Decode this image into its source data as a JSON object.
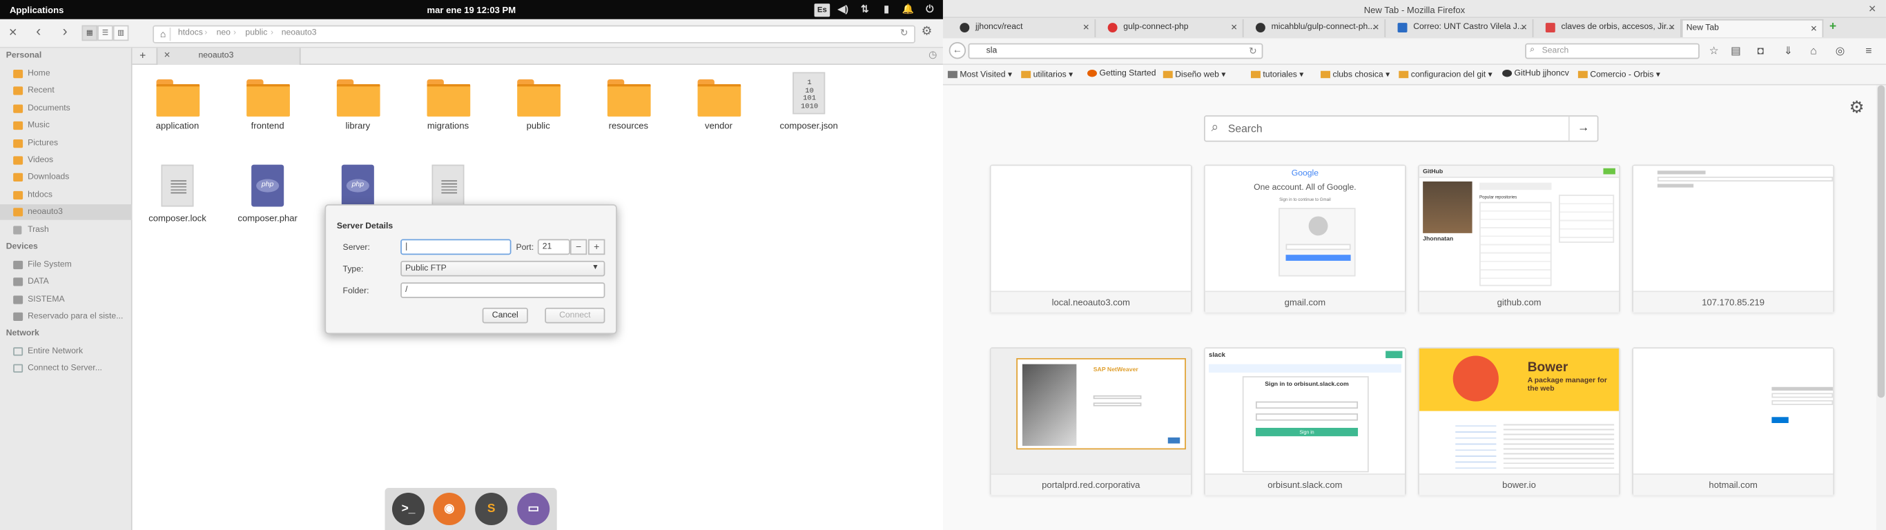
{
  "system": {
    "apps": "Applications",
    "clock": "mar ene 19   12:03 PM",
    "kb": "Es"
  },
  "fm": {
    "path": [
      "htdocs",
      "neo",
      "public",
      "neoauto3"
    ],
    "tab": "neoauto3",
    "sidebar": {
      "personal": "Personal",
      "items": [
        "Home",
        "Recent",
        "Documents",
        "Music",
        "Pictures",
        "Videos",
        "Downloads",
        "htdocs",
        "neoauto3",
        "Trash"
      ],
      "devices": "Devices",
      "dev_items": [
        "File System",
        "DATA",
        "SISTEMA",
        "Reservado para el siste..."
      ],
      "network": "Network",
      "net_items": [
        "Entire Network",
        "Connect to Server..."
      ]
    },
    "files": [
      "application",
      "frontend",
      "library",
      "migrations",
      "public",
      "resources",
      "vendor",
      "composer.json",
      "composer.lock",
      "composer.phar"
    ]
  },
  "dialog": {
    "title": "Server Details",
    "server": "Server:",
    "port": "Port:",
    "port_val": "21",
    "type": "Type:",
    "type_val": "Public FTP",
    "folder": "Folder:",
    "folder_val": "/",
    "cancel": "Cancel",
    "connect": "Connect"
  },
  "ff": {
    "window_title": "New Tab - Mozilla Firefox",
    "tabs": [
      "jjhoncv/react",
      "gulp-connect-php",
      "micahblu/gulp-connect-ph...",
      "Correo: UNT Castro Vilela J...",
      "claves de orbis, accesos, Jir...",
      "New Tab"
    ],
    "url": "sla",
    "search_ph": "Search",
    "bookmarks": [
      "Most Visited",
      "utilitarios",
      "Getting Started",
      "Diseño web",
      "tutoriales",
      "clubs chosica",
      "configuracion del git",
      "GitHub jjhoncv",
      "Comercio - Orbis"
    ],
    "nt_search": "Search",
    "tiles": [
      "local.neoauto3.com",
      "gmail.com",
      "github.com",
      "107.170.85.219",
      "portalprd.red.corporativa",
      "orbisunt.slack.com",
      "bower.io",
      "hotmail.com"
    ],
    "thumb": {
      "gmail_logo": "Google",
      "gmail_t1": "One account. All of Google.",
      "gmail_t2": "Sign in to continue to Gmail",
      "gh": "GitHub",
      "gh_name": "Jhonnatan",
      "gh_pop": "Popular repositories",
      "sap": "SAP NetWeaver",
      "slack": "slack",
      "slack_t1": "Sign in to orbisunt.slack.com",
      "slack_btn": "Sign in",
      "bower": "Bower",
      "bower_t": "A package manager for the web"
    }
  }
}
